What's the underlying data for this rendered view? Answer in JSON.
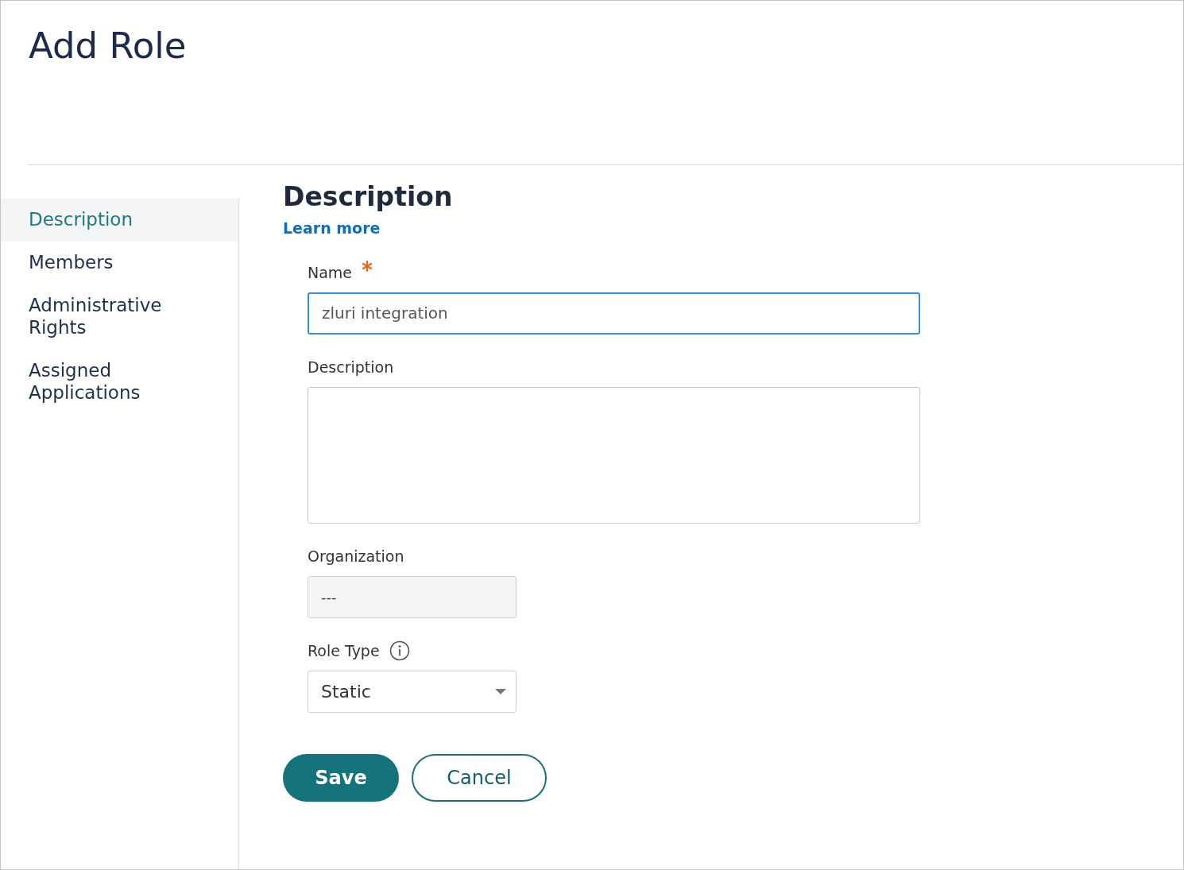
{
  "page": {
    "title": "Add Role"
  },
  "sidebar": {
    "items": [
      {
        "label": "Description",
        "selected": true
      },
      {
        "label": "Members",
        "selected": false
      },
      {
        "label": "Administrative Rights",
        "selected": false
      },
      {
        "label": "Assigned Applications",
        "selected": false
      }
    ]
  },
  "section": {
    "title": "Description",
    "link": "Learn more"
  },
  "fields": [
    {
      "kind": "text",
      "label": "Name",
      "required": true,
      "value": "zluri integration",
      "focused": true
    },
    {
      "kind": "textarea",
      "label": "Description",
      "required": false,
      "focused": false
    },
    {
      "kind": "readonly",
      "label": "Organization",
      "required": false,
      "value": "---",
      "focused": false
    },
    {
      "kind": "select",
      "label": "Role Type",
      "required": false,
      "info": true,
      "value": "Static",
      "focused": false
    }
  ],
  "buttons": [
    {
      "kind": "primary",
      "label": "Save"
    },
    {
      "kind": "secondary",
      "label": "Cancel"
    }
  ]
}
